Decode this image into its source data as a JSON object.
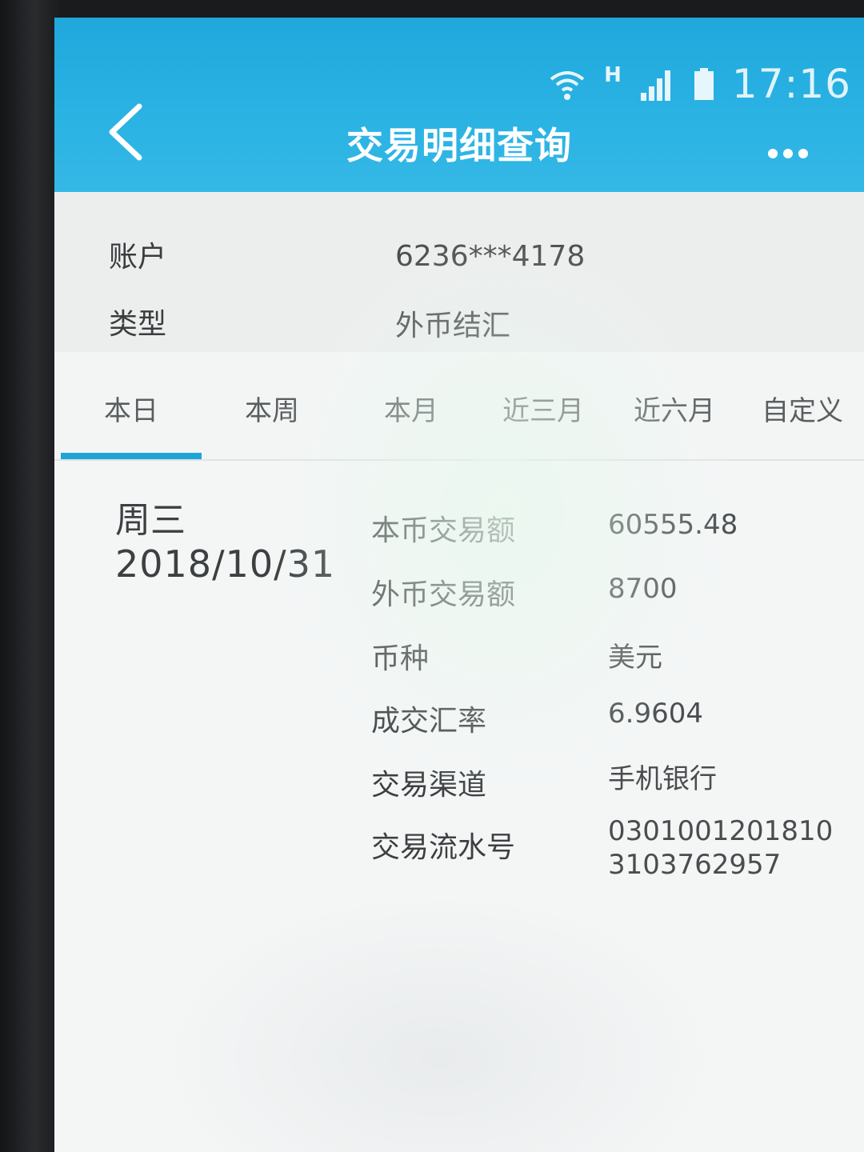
{
  "status_bar": {
    "network": "H",
    "time": "17:16",
    "icons": [
      "wifi-icon",
      "signal-icon",
      "battery-icon"
    ]
  },
  "header": {
    "title": "交易明细查询",
    "back_icon": "chevron-left-icon",
    "more_icon": "more-dots-icon"
  },
  "account_info": {
    "account_label": "账户",
    "account_value": "6236***4178",
    "type_label": "类型",
    "type_value": "外币结汇"
  },
  "tabs": [
    "本日",
    "本周",
    "本月",
    "近三月",
    "近六月",
    "自定义"
  ],
  "active_tab": "本日",
  "transaction": {
    "weekday": "周三",
    "date": "2018/10/31",
    "fields": [
      {
        "label": "本币交易额",
        "value": "60555.48"
      },
      {
        "label": "外币交易额",
        "value": "8700"
      },
      {
        "label": "币种",
        "value": "美元"
      },
      {
        "label": "成交汇率",
        "value": "6.9604"
      },
      {
        "label": "交易渠道",
        "value": "手机银行"
      },
      {
        "label": "交易流水号",
        "value_line1": "0301001201810",
        "value_line2": "3103762957"
      }
    ]
  },
  "colors": {
    "header_blue": "#2ab3e3",
    "tab_indicator": "#1fa4d8",
    "background": "#f4f6f6"
  }
}
